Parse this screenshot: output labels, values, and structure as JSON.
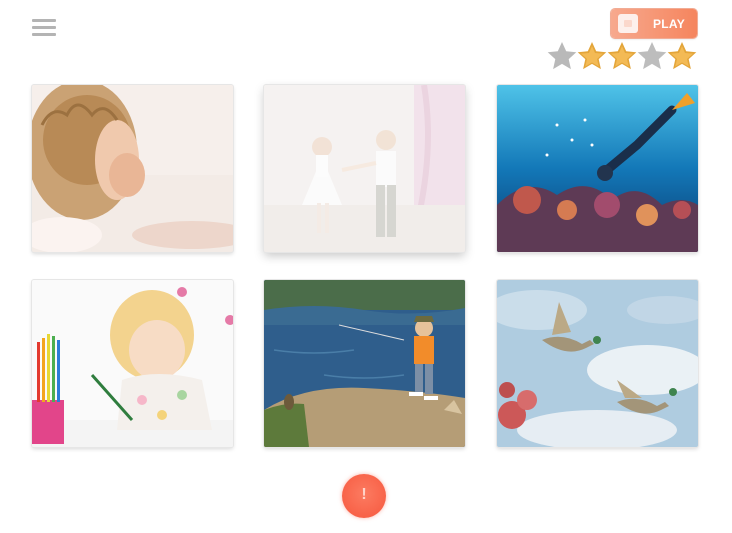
{
  "header": {
    "menu_icon": "hamburger-menu-icon",
    "play_button": {
      "label": "PLAY",
      "icon": "play-icon",
      "color": "#f5855e"
    }
  },
  "rating": {
    "value": 3,
    "max": 5,
    "filled_color": "#f0b54a",
    "empty_color": "#b9b9b9"
  },
  "gallery": {
    "tiles": [
      {
        "subject": "child-hiding-face",
        "selected": false
      },
      {
        "subject": "children-dancing",
        "selected": true
      },
      {
        "subject": "scuba-diver-coral-reef",
        "selected": false
      },
      {
        "subject": "girl-drawing-with-pencils",
        "selected": false
      },
      {
        "subject": "boy-fishing-at-lake",
        "selected": false
      },
      {
        "subject": "flying-ducks",
        "selected": false
      }
    ]
  },
  "footer": {
    "alert_button": {
      "label": "!",
      "color": "#f86248"
    }
  }
}
